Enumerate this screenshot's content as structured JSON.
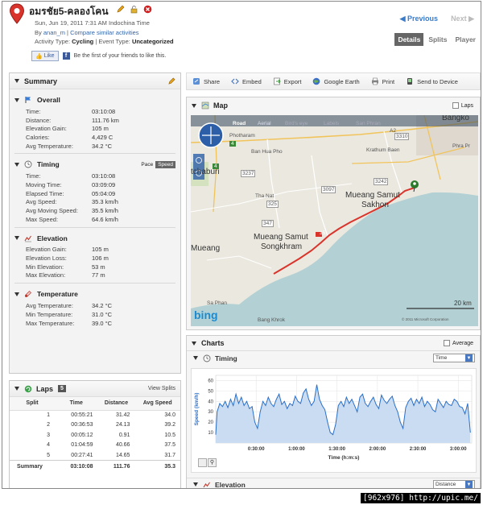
{
  "activity": {
    "title": "อมรชัย5-คลองโคน",
    "date_line": "Sun, Jun 19, 2011 7:31 AM Indochina Time",
    "by_prefix": "By",
    "user": "anan_m",
    "compare_link": "Compare similar activities",
    "activity_type_label": "Activity Type:",
    "activity_type": "Cycling",
    "event_type_label": "| Event Type:",
    "event_type": "Uncategorized",
    "like_label": "Like",
    "like_text": "Be the first of your friends to like this."
  },
  "nav": {
    "previous": "Previous",
    "next": "Next",
    "tabs": [
      "Details",
      "Splits",
      "Player"
    ],
    "active_tab": "Details"
  },
  "summary": {
    "title": "Summary",
    "overall": {
      "title": "Overall",
      "rows": [
        {
          "k": "Time:",
          "v": "03:10:08"
        },
        {
          "k": "Distance:",
          "v": "111.76 km"
        },
        {
          "k": "Elevation Gain:",
          "v": "105 m"
        },
        {
          "k": "Calories:",
          "v": "4,429 C"
        },
        {
          "k": "Avg Temperature:",
          "v": "34.2 °C"
        }
      ]
    },
    "timing": {
      "title": "Timing",
      "toggle": [
        "Pace",
        "Speed"
      ],
      "rows": [
        {
          "k": "Time:",
          "v": "03:10:08"
        },
        {
          "k": "Moving Time:",
          "v": "03:09:09"
        },
        {
          "k": "Elapsed Time:",
          "v": "05:04:09"
        },
        {
          "k": "Avg Speed:",
          "v": "35.3 km/h"
        },
        {
          "k": "Avg Moving Speed:",
          "v": "35.5 km/h"
        },
        {
          "k": "Max Speed:",
          "v": "64.6 km/h"
        }
      ]
    },
    "elevation": {
      "title": "Elevation",
      "rows": [
        {
          "k": "Elevation Gain:",
          "v": "105 m"
        },
        {
          "k": "Elevation Loss:",
          "v": "106 m"
        },
        {
          "k": "Min Elevation:",
          "v": "53 m"
        },
        {
          "k": "Max Elevation:",
          "v": "77 m"
        }
      ]
    },
    "temperature": {
      "title": "Temperature",
      "rows": [
        {
          "k": "Avg Temperature:",
          "v": "34.2 °C"
        },
        {
          "k": "Min Temperature:",
          "v": "31.0 °C"
        },
        {
          "k": "Max Temperature:",
          "v": "39.0 °C"
        }
      ]
    }
  },
  "laps": {
    "title": "Laps",
    "count": "5",
    "view_splits": "View Splits",
    "headers": [
      "Split",
      "Time",
      "Distance",
      "Avg Speed"
    ],
    "rows": [
      [
        "1",
        "00:55:21",
        "31.42",
        "34.0"
      ],
      [
        "2",
        "00:36:53",
        "24.13",
        "39.2"
      ],
      [
        "3",
        "00:05:12",
        "0.91",
        "10.5"
      ],
      [
        "4",
        "01:04:59",
        "40.66",
        "37.5"
      ],
      [
        "5",
        "00:27:41",
        "14.65",
        "31.7"
      ]
    ],
    "total": [
      "Summary",
      "03:10:08",
      "111.76",
      "35.3"
    ]
  },
  "toolbar": [
    "Share",
    "Embed",
    "Export",
    "Google Earth",
    "Print",
    "Send to Device"
  ],
  "map": {
    "title": "Map",
    "laps_toggle": "Laps",
    "tabs": [
      "Road",
      "Aerial",
      "Bird's eye",
      "Labels",
      "San Phran"
    ],
    "labels": {
      "bangkok": "Bangko",
      "photharam": "Photharam",
      "ban_hua_pho": "Ban Hua Pho",
      "ratchaburi": "tchaburi",
      "mueang": "Mueang",
      "ms_sakhon_1": "Mueang Samut",
      "ms_sakhon_2": "Sakhon",
      "ms_song_1": "Mueang Samut",
      "ms_song_2": "Songkhram",
      "tha_nat": "Tha Nat",
      "krathum": "Krathum Baen",
      "phra_pradaeng": "Phra Pr",
      "sa_phan": "Sa Phan",
      "bang_khrok": "Bang Khrok",
      "scale": "20 km",
      "bing": "bing",
      "copyright": "© 2011 Microsoft Corporation",
      "r4": "4",
      "r4b": "4",
      "r3237": "3237",
      "r325": "325",
      "r347": "347",
      "r3097": "3097",
      "r3310": "3310",
      "r35": "35",
      "r3242": "3242",
      "a2": "A2"
    }
  },
  "charts": {
    "title": "Charts",
    "average_toggle": "Average",
    "timing_title": "Timing",
    "timing_select": "Time",
    "elevation_title": "Elevation",
    "elevation_select": "Distance"
  },
  "chart_data": {
    "type": "area",
    "title": "",
    "xlabel": "Time (h:m:s)",
    "ylabel": "Speed (km/h)",
    "x_ticks": [
      "0:30:00",
      "1:00:00",
      "1:30:00",
      "2:00:00",
      "2:30:00",
      "3:00:00"
    ],
    "y_ticks": [
      10,
      20,
      30,
      40,
      50,
      60
    ],
    "xlim_minutes": [
      0,
      190
    ],
    "ylim": [
      0,
      65
    ],
    "x_minutes": [
      0,
      1,
      3,
      5,
      7,
      9,
      11,
      13,
      15,
      17,
      19,
      21,
      23,
      25,
      27,
      29,
      31,
      33,
      35,
      37,
      39,
      41,
      43,
      45,
      47,
      49,
      51,
      53,
      55,
      57,
      59,
      61,
      63,
      65,
      67,
      69,
      71,
      73,
      75,
      77,
      79,
      81,
      83,
      85,
      87,
      89,
      91,
      93,
      95,
      97,
      99,
      101,
      103,
      105,
      107,
      109,
      111,
      113,
      115,
      117,
      119,
      121,
      123,
      125,
      127,
      129,
      131,
      133,
      135,
      137,
      139,
      141,
      143,
      145,
      147,
      149,
      151,
      153,
      155,
      157,
      159,
      161,
      163,
      165,
      167,
      169,
      171,
      173,
      175,
      177,
      179,
      181,
      183,
      185,
      187,
      189
    ],
    "y_speed": [
      8,
      30,
      38,
      35,
      40,
      34,
      42,
      36,
      47,
      38,
      44,
      36,
      40,
      33,
      35,
      20,
      14,
      30,
      40,
      36,
      44,
      38,
      35,
      42,
      47,
      37,
      40,
      33,
      38,
      36,
      45,
      40,
      38,
      48,
      52,
      42,
      36,
      40,
      56,
      42,
      36,
      32,
      20,
      10,
      8,
      18,
      36,
      40,
      35,
      44,
      38,
      42,
      36,
      30,
      44,
      47,
      38,
      35,
      40,
      44,
      37,
      33,
      46,
      41,
      38,
      42,
      45,
      36,
      30,
      20,
      14,
      34,
      40,
      43,
      36,
      42,
      38,
      44,
      35,
      40,
      37,
      32,
      30,
      42,
      38,
      34,
      40,
      37,
      36,
      42,
      40,
      35,
      34,
      28,
      38,
      10
    ]
  },
  "watermark": "[962x976] http://upic.me/"
}
